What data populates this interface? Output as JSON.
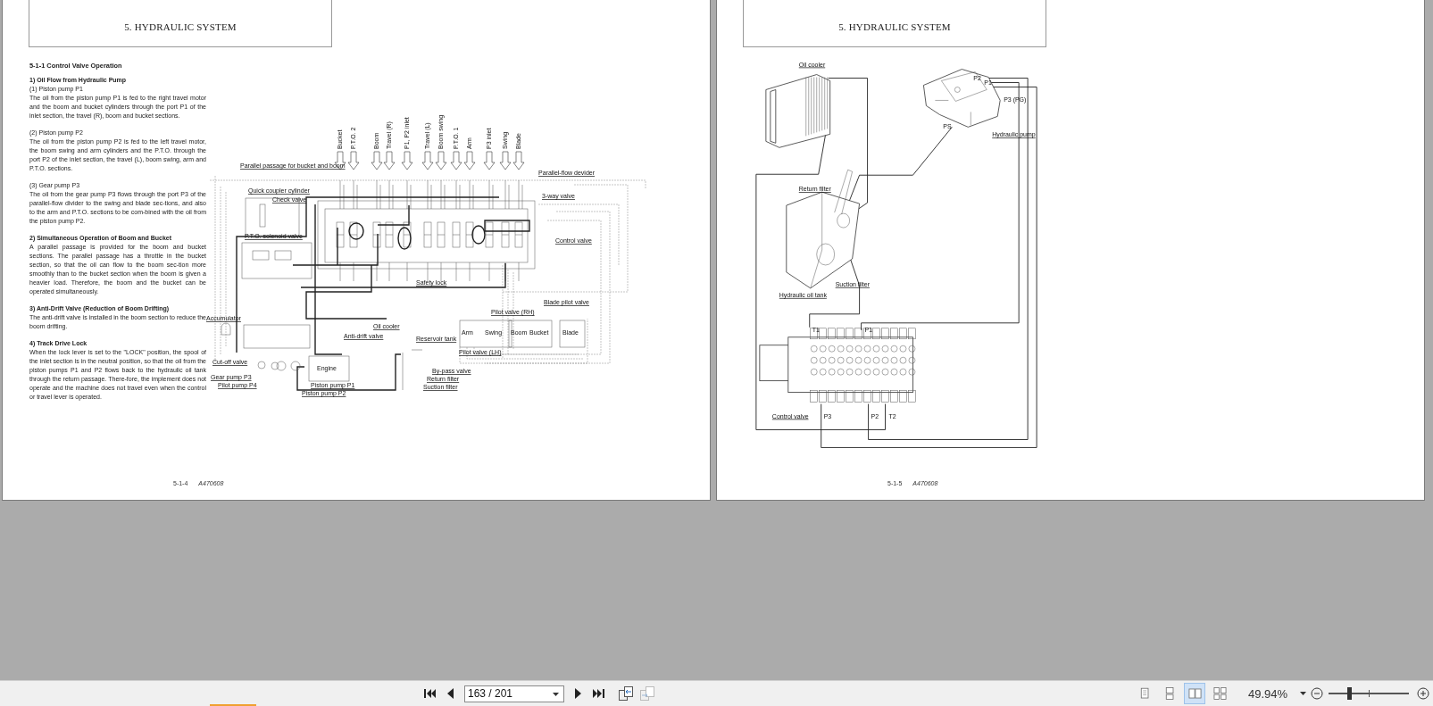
{
  "pages": [
    {
      "kind": "text-and-schematic",
      "header": "5. HYDRAULIC SYSTEM",
      "text": [
        {
          "kind": "title",
          "text": "5-1-1  Control Valve Operation"
        },
        {
          "kind": "heading",
          "text": "1)  Oil Flow from Hydraulic Pump"
        },
        {
          "kind": "sub",
          "text": "(1)   Piston pump P1"
        },
        {
          "kind": "para",
          "text": "The oil from the piston pump P1 is fed to the right travel motor and the boom and bucket cylinders through the port P1 of the inlet section, the travel (R), boom and bucket sections."
        },
        {
          "kind": "sub",
          "text": "(2)   Piston pump P2"
        },
        {
          "kind": "para",
          "text": "The oil from the piston pump P2 is fed to the left travel motor, the boom swing and arm cylinders and the P.T.O. through the port P2 of the inlet section, the travel (L), boom swing, arm and P.T.O. sections."
        },
        {
          "kind": "sub",
          "text": "(3)   Gear pump P3"
        },
        {
          "kind": "para",
          "text": "The oil from the gear pump P3 flows through the port P3 of the parallel-flow divider to the swing and blade sec-tions, and also to the arm and P.T.O. sections to be com-bined with the oil from the piston pump P2."
        },
        {
          "kind": "heading",
          "text": "2)  Simultaneous Operation of Boom and Bucket"
        },
        {
          "kind": "para",
          "text": "A parallel passage is provided for the boom and bucket sections. The parallel passage has a throttle in the bucket section, so that the oil can flow to the boom sec-tion more smoothly than to the bucket section when the boom is given a heavier load. Therefore, the boom and the bucket can be operated simultaneously."
        },
        {
          "kind": "heading",
          "text": "3)  Anti-Drift Valve (Reduction of Boom Drifting)"
        },
        {
          "kind": "para",
          "text": "The anti-drift valve is installed in the boom section to reduce the boom drifting."
        },
        {
          "kind": "heading",
          "text": "4)  Track Drive Lock"
        },
        {
          "kind": "para",
          "text": "When the lock lever is set to the \"LOCK\" position, the spool of the inlet section is in the neutral position, so that the oil from the piston pumps P1 and P2 flows back to the hydraulic oil tank through the return passage. There-fore, the implement does not operate and the machine does not travel even when the control or travel lever is operated."
        }
      ],
      "sections": [
        "Bucket",
        "P.T.O. 2",
        "Boom",
        "Travel (R)",
        "P1, P2 inlet",
        "Travel (L)",
        "Boom swing",
        "P.T.O. 1",
        "Arm",
        "P3 inlet",
        "Swing",
        "Blade"
      ],
      "labels": [
        "Parallel passage for bucket and boom",
        "Parallel-flow devider",
        "Quick coupler cylinder",
        "Check valve",
        "3-way valve",
        "P.T.O. solenoid valve",
        "Control valve",
        "Safety lock",
        "Blade pilot valve",
        "Pilot valve (RH)",
        "Accumulator",
        "Oil cooler",
        "Anti-drift valve",
        "Reservoir tank",
        "Pilot valve (LH)",
        "Cut-off valve",
        "Gear pump P3",
        "Pilot pump P4",
        "Engine",
        "Piston pump P1",
        "Piston pump P2",
        "By-pass valve",
        "Return filter",
        "Suction filter",
        "Arm",
        "Swing",
        "Boom",
        "Bucket",
        "Blade"
      ],
      "footer": {
        "page": "5-1-4",
        "code": "A470608"
      }
    },
    {
      "kind": "layout",
      "header": "5. HYDRAULIC SYSTEM",
      "labels": [
        "Oil cooler",
        "P2",
        "P1",
        "P3 (PG)",
        "PS",
        "Hydraulic pump",
        "Return filter",
        "Suction filter",
        "Hydraulic oil tank",
        "T1",
        "P1",
        "Control valve",
        "P3",
        "P2",
        "T2"
      ],
      "footer": {
        "page": "5-1-5",
        "code": "A470608"
      }
    }
  ],
  "toolbar": {
    "page_field": "163 / 201",
    "zoom": "49.94%",
    "zoom_level": {
      "level": 0.25
    },
    "view_modes": [
      {
        "kind": "single",
        "selected": false
      },
      {
        "kind": "continuous",
        "selected": false
      },
      {
        "kind": "facing",
        "selected": true
      },
      {
        "kind": "continuous-facing",
        "selected": false
      }
    ]
  }
}
